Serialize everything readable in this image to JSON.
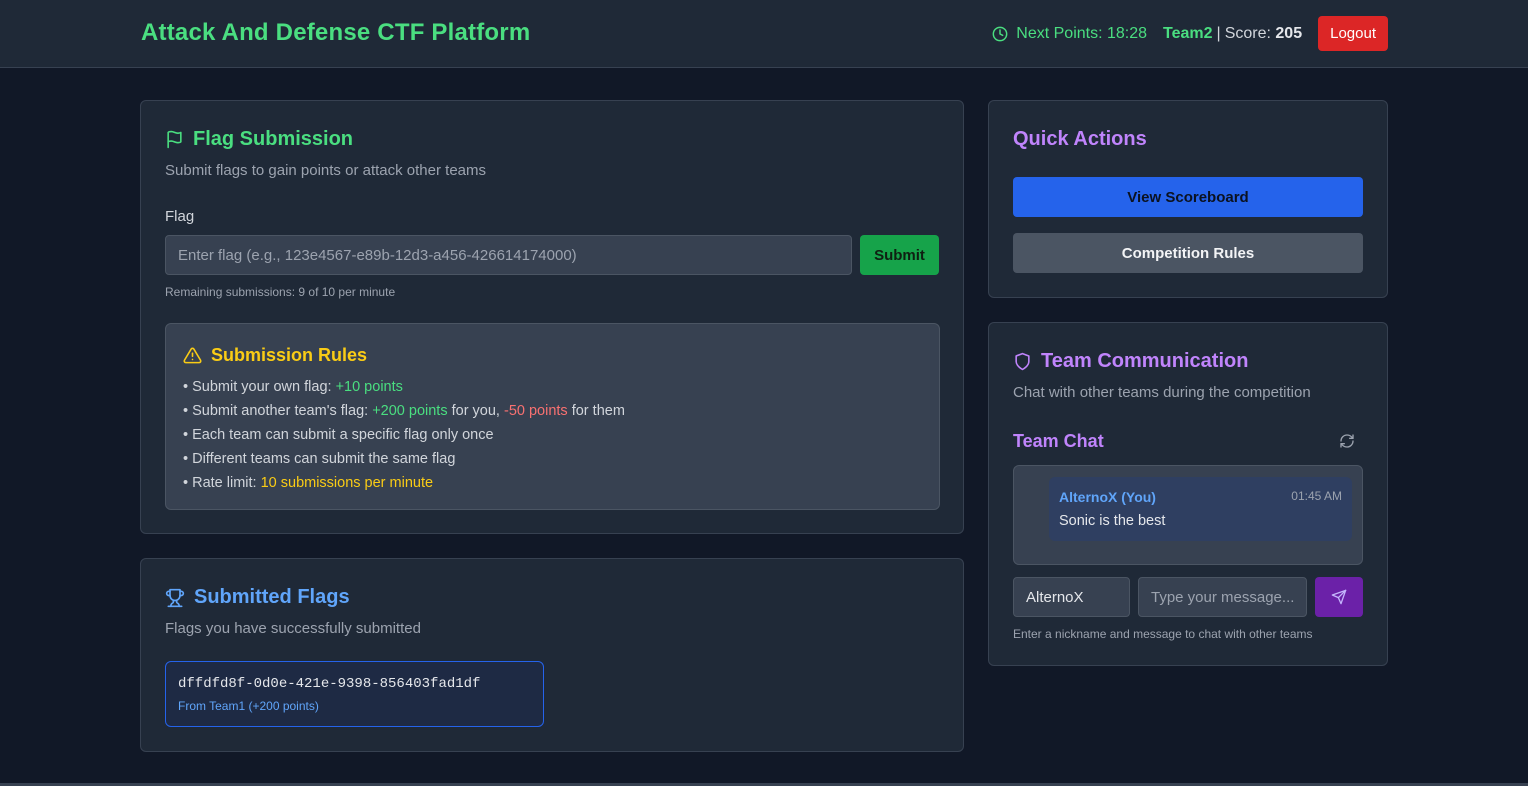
{
  "header": {
    "title": "Attack And Defense CTF Platform",
    "timer_label": "Next Points: 18:28",
    "team_name": "Team2",
    "score_label": "Score:",
    "score_value": "205",
    "logout_label": "Logout"
  },
  "flag_submission": {
    "title": "Flag Submission",
    "subtitle": "Submit flags to gain points or attack other teams",
    "flag_label": "Flag",
    "input_placeholder": "Enter flag (e.g., 123e4567-e89b-12d3-a456-426614174000)",
    "input_value": "",
    "submit_label": "Submit",
    "remaining": "Remaining submissions: 9 of 10 per minute"
  },
  "rules": {
    "title": "Submission Rules",
    "items": [
      {
        "prefix": "• Submit your own flag: ",
        "highlight": "+10 points"
      },
      {
        "prefix": "• Submit another team's flag: ",
        "highlight": "+200 points",
        "mid": " for you, ",
        "highlight2": "-50 points",
        "suffix": " for them"
      },
      {
        "prefix": "• Each team can submit a specific flag only once"
      },
      {
        "prefix": "• Different teams can submit the same flag"
      },
      {
        "prefix": "• Rate limit: ",
        "highlight": "10 submissions per minute"
      }
    ]
  },
  "submitted_flags": {
    "title": "Submitted Flags",
    "subtitle": "Flags you have successfully submitted",
    "flags": [
      {
        "value": "dffdfd8f-0d0e-421e-9398-856403fad1df",
        "source": "From Team1 (+200 points)"
      }
    ]
  },
  "quick_actions": {
    "title": "Quick Actions",
    "scoreboard_label": "View Scoreboard",
    "rules_label": "Competition Rules"
  },
  "team_comm": {
    "title": "Team Communication",
    "subtitle": "Chat with other teams during the competition",
    "chat_title": "Team Chat",
    "messages": [
      {
        "author": "AlternoX (You)",
        "time": "01:45 AM",
        "text": "Sonic is the best"
      }
    ],
    "nickname_value": "AlternoX",
    "message_placeholder": "Type your message...",
    "hint": "Enter a nickname and message to chat with other teams"
  },
  "colors": {
    "background": "#111827",
    "panel": "#1f2937",
    "accent_green": "#4ade80",
    "accent_purple": "#c084fc",
    "accent_blue": "#60a5fa",
    "logout_red": "#dc2626",
    "submit_green": "#16a34a",
    "scoreboard_blue": "#2563eb",
    "send_purple": "#6b21a8"
  },
  "icons": [
    "clock-icon",
    "flag-icon",
    "warning-icon",
    "trophy-icon",
    "shield-icon",
    "refresh-icon",
    "send-icon"
  ]
}
